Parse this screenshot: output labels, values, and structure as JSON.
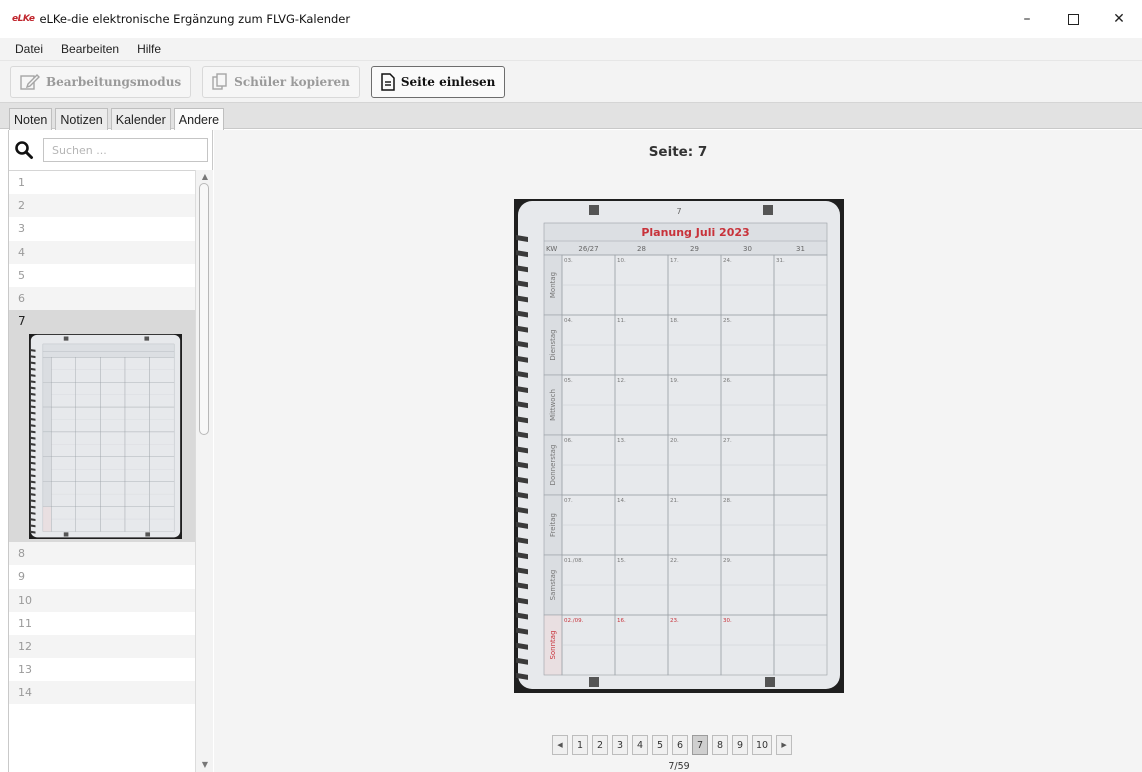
{
  "window": {
    "logo_text": "eLKe",
    "title": "eLKe-die elektronische Ergänzung zum FLVG-Kalender",
    "minimize": "–",
    "close": "✕"
  },
  "menu": {
    "items": [
      "Datei",
      "Bearbeiten",
      "Hilfe"
    ]
  },
  "toolbar": {
    "edit_mode_label": "Bearbeitungsmodus",
    "copy_students_label": "Schüler kopieren",
    "read_page_label": "Seite einlesen"
  },
  "tabs": [
    "Noten",
    "Notizen",
    "Kalender",
    "Andere"
  ],
  "tabs_active_index": 3,
  "search": {
    "placeholder": "Suchen ..."
  },
  "page_list": {
    "items": [
      "1",
      "2",
      "3",
      "4",
      "5",
      "6",
      "7",
      "8",
      "9",
      "10",
      "11",
      "12",
      "13",
      "14"
    ],
    "selected": "7"
  },
  "viewer": {
    "title": "Seite: 7",
    "scan": {
      "page_number": "7",
      "heading": "Planung Juli 2023",
      "kw_label": "KW",
      "weeks": [
        "26/27",
        "28",
        "29",
        "30",
        "31"
      ],
      "days": [
        "Montag",
        "Dienstag",
        "Mittwoch",
        "Donnerstag",
        "Freitag",
        "Samstag",
        "Sonntag"
      ],
      "dates": [
        [
          "03.",
          "10.",
          "17.",
          "24.",
          "31."
        ],
        [
          "04.",
          "11.",
          "18.",
          "25.",
          ""
        ],
        [
          "05.",
          "12.",
          "19.",
          "26.",
          ""
        ],
        [
          "06.",
          "13.",
          "20.",
          "27.",
          ""
        ],
        [
          "07.",
          "14.",
          "21.",
          "28.",
          ""
        ],
        [
          "01./08.",
          "15.",
          "22.",
          "29.",
          ""
        ],
        [
          "02./09.",
          "16.",
          "23.",
          "30.",
          ""
        ]
      ],
      "accent_color": "#c8323a"
    }
  },
  "pager": {
    "prev": "◀",
    "next": "▶",
    "pages": [
      "1",
      "2",
      "3",
      "4",
      "5",
      "6",
      "7",
      "8",
      "9",
      "10"
    ],
    "current": "7",
    "status": "7/59"
  }
}
